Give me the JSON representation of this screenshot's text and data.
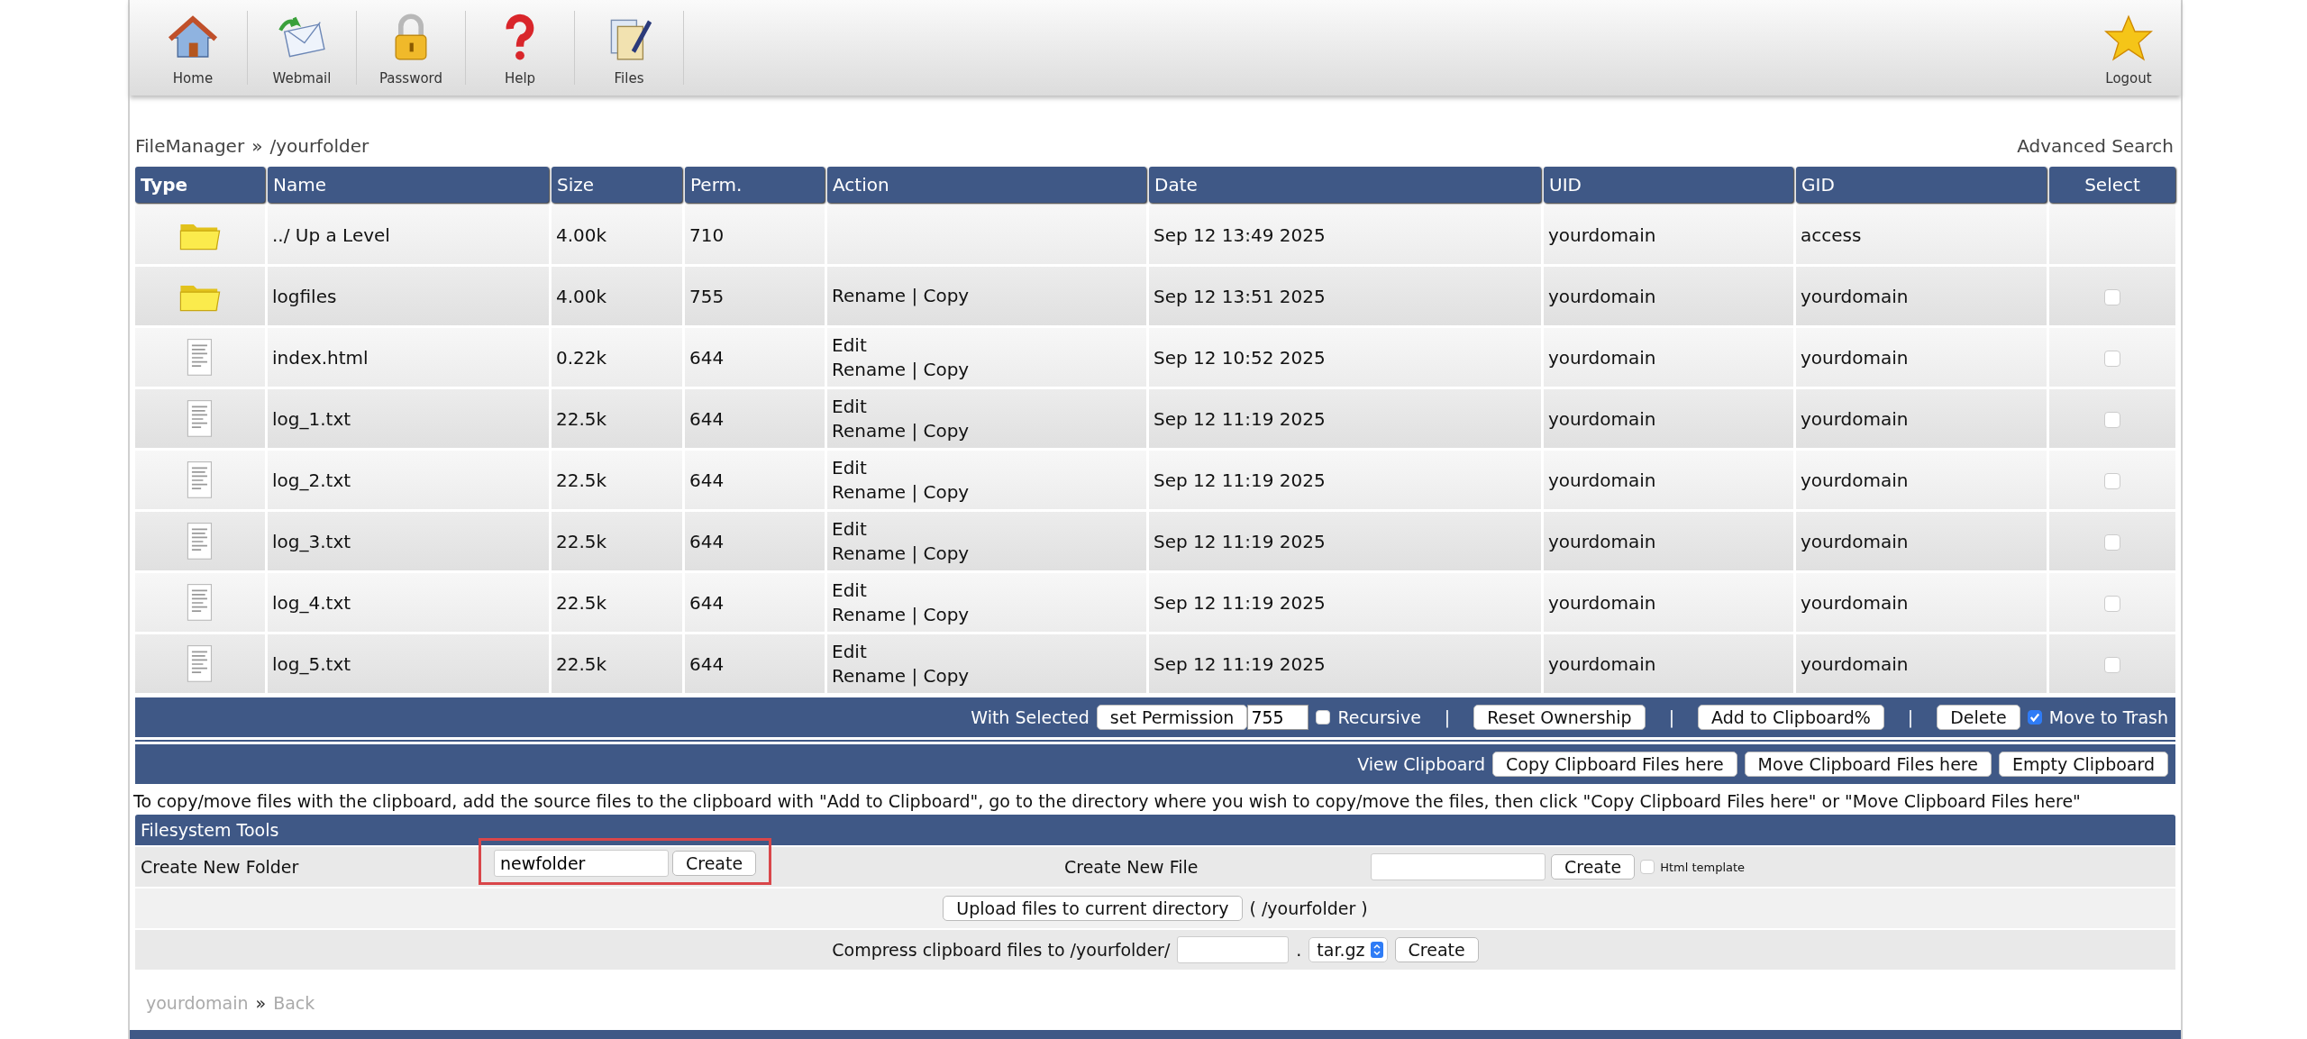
{
  "toolbar": {
    "items": [
      {
        "label": "Home",
        "kind": "home"
      },
      {
        "label": "Webmail",
        "kind": "mail"
      },
      {
        "label": "Password",
        "kind": "lock"
      },
      {
        "label": "Help",
        "kind": "help"
      },
      {
        "label": "Files",
        "kind": "files"
      }
    ],
    "logout": {
      "label": "Logout"
    }
  },
  "breadcrumb": {
    "root": "FileManager",
    "separator": "»",
    "path": "/yourfolder"
  },
  "advanced_search": "Advanced Search",
  "table": {
    "columns": [
      "Type",
      "Name",
      "Size",
      "Perm.",
      "Action",
      "Date",
      "UID",
      "GID",
      "Select"
    ],
    "rows": [
      {
        "kind": "folder",
        "name": "../ Up a Level",
        "size": "4.00k",
        "perm": "710",
        "actions": [],
        "date": "Sep 12 13:49 2025",
        "uid": "yourdomain",
        "gid": "access"
      },
      {
        "kind": "folder",
        "name": "logfiles",
        "size": "4.00k",
        "perm": "755",
        "actions": [
          "Rename | Copy"
        ],
        "date": "Sep 12 13:51 2025",
        "uid": "yourdomain",
        "gid": "yourdomain",
        "checked": false
      },
      {
        "kind": "file",
        "name": "index.html",
        "size": "0.22k",
        "perm": "644",
        "actions": [
          "Edit",
          "Rename | Copy"
        ],
        "date": "Sep 12 10:52 2025",
        "uid": "yourdomain",
        "gid": "yourdomain",
        "checked": false
      },
      {
        "kind": "file",
        "name": "log_1.txt",
        "size": "22.5k",
        "perm": "644",
        "actions": [
          "Edit",
          "Rename | Copy"
        ],
        "date": "Sep 12 11:19 2025",
        "uid": "yourdomain",
        "gid": "yourdomain",
        "checked": false
      },
      {
        "kind": "file",
        "name": "log_2.txt",
        "size": "22.5k",
        "perm": "644",
        "actions": [
          "Edit",
          "Rename | Copy"
        ],
        "date": "Sep 12 11:19 2025",
        "uid": "yourdomain",
        "gid": "yourdomain",
        "checked": false
      },
      {
        "kind": "file",
        "name": "log_3.txt",
        "size": "22.5k",
        "perm": "644",
        "actions": [
          "Edit",
          "Rename | Copy"
        ],
        "date": "Sep 12 11:19 2025",
        "uid": "yourdomain",
        "gid": "yourdomain",
        "checked": false
      },
      {
        "kind": "file",
        "name": "log_4.txt",
        "size": "22.5k",
        "perm": "644",
        "actions": [
          "Edit",
          "Rename | Copy"
        ],
        "date": "Sep 12 11:19 2025",
        "uid": "yourdomain",
        "gid": "yourdomain",
        "checked": false
      },
      {
        "kind": "file",
        "name": "log_5.txt",
        "size": "22.5k",
        "perm": "644",
        "actions": [
          "Edit",
          "Rename | Copy"
        ],
        "date": "Sep 12 11:19 2025",
        "uid": "yourdomain",
        "gid": "yourdomain",
        "checked": false
      }
    ]
  },
  "with_selected": {
    "label": "With Selected",
    "permission_button": "set Permission",
    "permission_value": "755",
    "recursive": {
      "label": "Recursive",
      "checked": false
    },
    "separator": "|",
    "reset_button": "Reset Ownership",
    "clipboard_button": "Add to Clipboard%",
    "delete_button": "Delete",
    "trash": {
      "label": "Move to Trash",
      "checked": true
    }
  },
  "clipboard": {
    "label": "View Clipboard",
    "buttons": [
      "Copy Clipboard Files here",
      "Move Clipboard Files here",
      "Empty Clipboard"
    ]
  },
  "hint": "To copy/move files with the clipboard, add the source files to the clipboard with \"Add to Clipboard\", go to the directory where you wish to copy/move the files, then click \"Copy Clipboard Files here\" or \"Move Clipboard Files here\"",
  "tools": {
    "title": "Filesystem Tools",
    "new_folder": {
      "label": "Create New Folder",
      "value": "newfolder",
      "button": "Create",
      "highlighted": true
    },
    "new_file": {
      "label": "Create New File",
      "button": "Create",
      "template": {
        "label": "Html template",
        "checked": false
      }
    },
    "upload": {
      "button": "Upload files to current directory",
      "path": "( /yourfolder )"
    },
    "compress": {
      "label": "Compress clipboard files to /yourfolder/",
      "dot": ".",
      "format": "tar.gz",
      "button": "Create"
    }
  },
  "footer": {
    "domain": "yourdomain",
    "separator": "»",
    "back": "Back"
  }
}
